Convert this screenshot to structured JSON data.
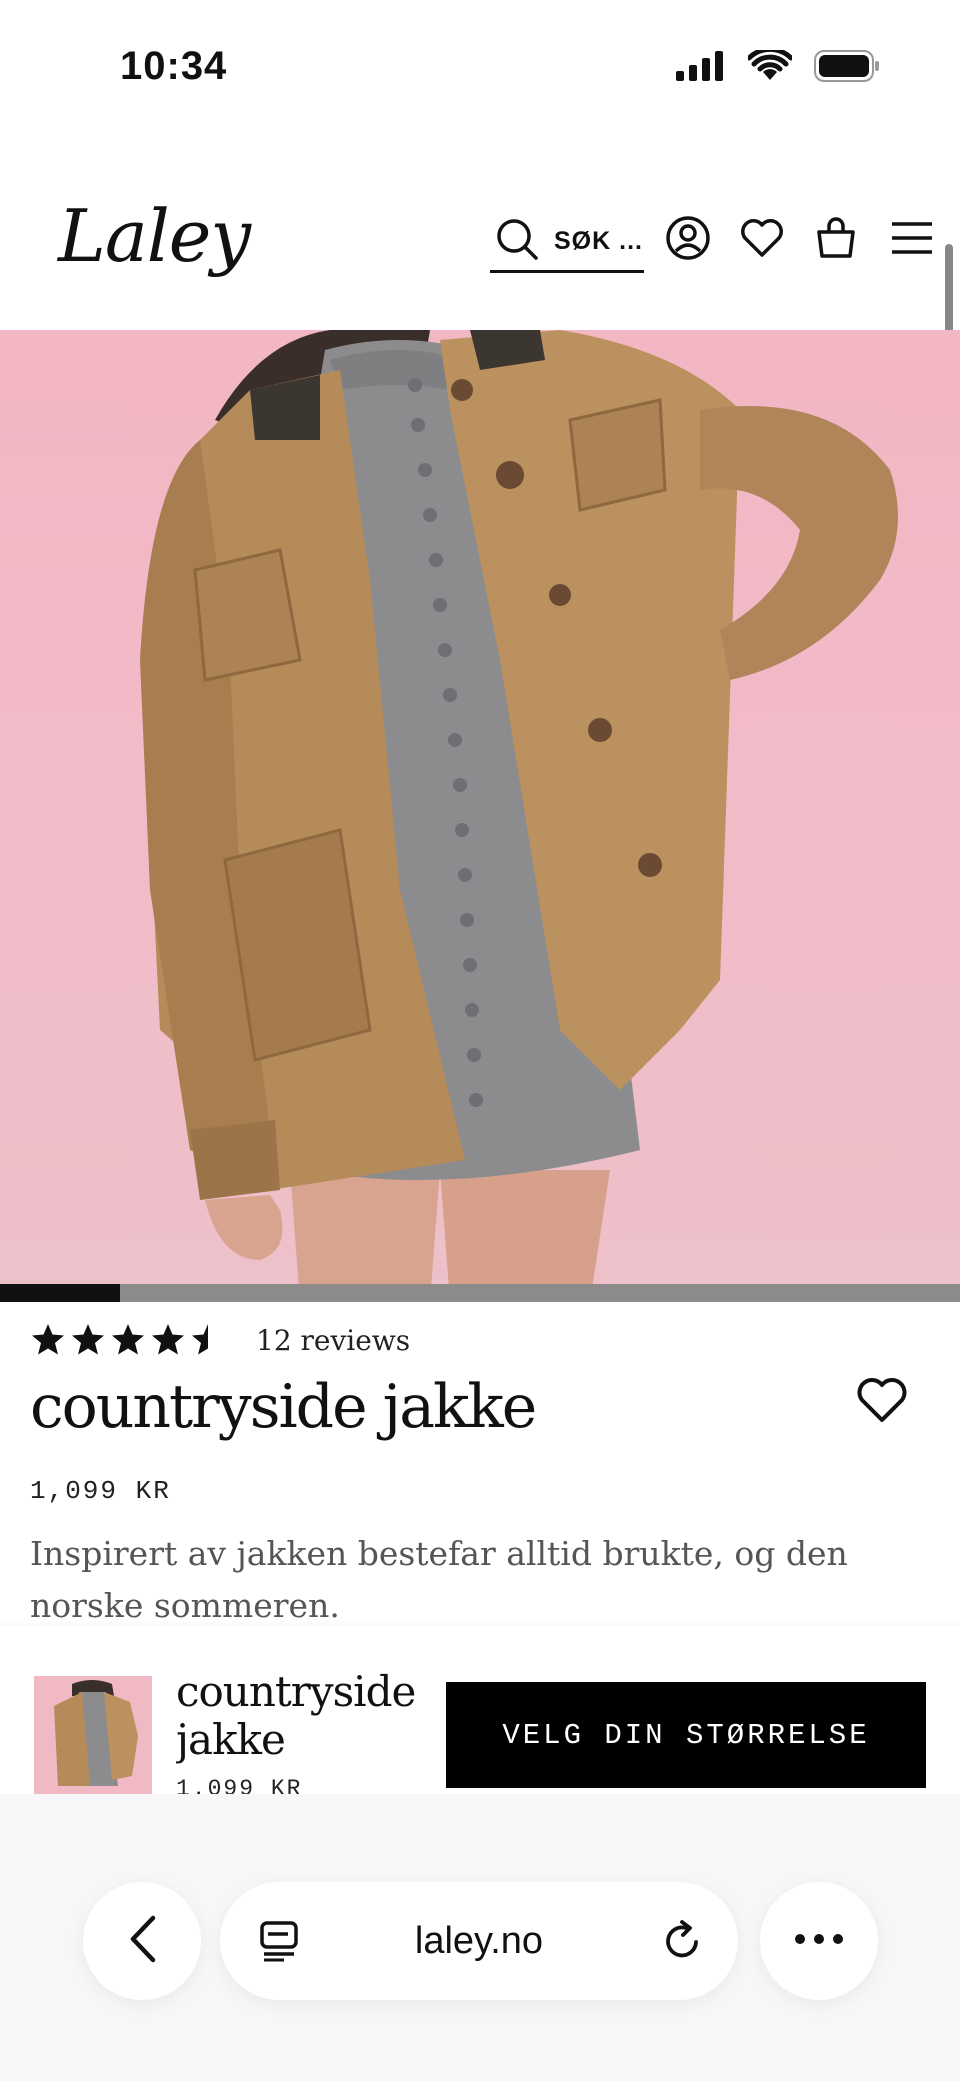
{
  "status_bar": {
    "time": "10:34"
  },
  "header": {
    "logo": "Laley",
    "search_label": "SØK ...",
    "icons": [
      "search-icon",
      "account-icon",
      "heart-icon",
      "bag-icon",
      "menu-icon"
    ]
  },
  "gallery": {
    "progress": 0.125
  },
  "product": {
    "rating": 4.5,
    "reviews_text": "12 reviews",
    "title": "countryside jakke",
    "price": "1,099 KR",
    "description": "Inspirert av jakken bestefar alltid brukte, og den norske sommeren."
  },
  "sticky_bar": {
    "title_line1": "countryside",
    "title_line2": "jakke",
    "price": "1.099 KR",
    "button_label": "VELG DIN STØRRELSE"
  },
  "browser": {
    "url": "laley.no"
  },
  "colors": {
    "background": "#ffffff",
    "hero_pink": "#f3b6c3",
    "button_black": "#000000",
    "text_gray": "#555555"
  }
}
